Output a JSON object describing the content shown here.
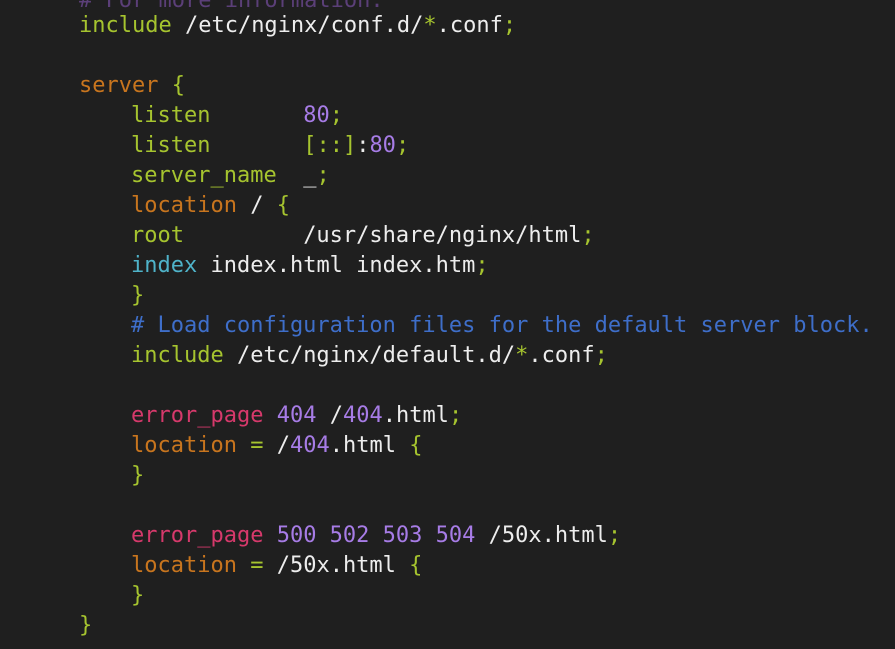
{
  "editor": {
    "colors": {
      "background": "#1f1f1f",
      "directive": "#a6c42f",
      "block_keyword": "#c8751e",
      "error_page": "#d6396b",
      "index": "#4fb3c9",
      "number": "#a77ce6",
      "comment": "#3e6ec9",
      "text": "#ededed"
    },
    "lines": [
      {
        "tokens": [
          {
            "t": "# For more information.",
            "c": "comment-faded"
          }
        ]
      },
      {
        "tokens": [
          {
            "t": "include",
            "c": "kw"
          },
          {
            "t": " /etc/nginx/conf.d/",
            "c": "text"
          },
          {
            "t": "*",
            "c": "kw"
          },
          {
            "t": ".conf",
            "c": "text"
          },
          {
            "t": ";",
            "c": "punct"
          }
        ]
      },
      {
        "tokens": []
      },
      {
        "tokens": [
          {
            "t": "server",
            "c": "orange"
          },
          {
            "t": " ",
            "c": "text"
          },
          {
            "t": "{",
            "c": "punct"
          }
        ]
      },
      {
        "tokens": [
          {
            "t": "listen",
            "c": "kw"
          },
          {
            "t": "       ",
            "c": "text"
          },
          {
            "t": "80",
            "c": "num"
          },
          {
            "t": ";",
            "c": "punct"
          }
        ]
      },
      {
        "tokens": [
          {
            "t": "listen",
            "c": "kw"
          },
          {
            "t": "       ",
            "c": "text"
          },
          {
            "t": "[::]",
            "c": "kw"
          },
          {
            "t": ":",
            "c": "text"
          },
          {
            "t": "80",
            "c": "num"
          },
          {
            "t": ";",
            "c": "punct"
          }
        ]
      },
      {
        "tokens": [
          {
            "t": "server_name",
            "c": "kw"
          },
          {
            "t": "  _",
            "c": "text"
          },
          {
            "t": ";",
            "c": "punct"
          }
        ]
      },
      {
        "tokens": [
          {
            "t": "location",
            "c": "orange"
          },
          {
            "t": " / ",
            "c": "text"
          },
          {
            "t": "{",
            "c": "punct"
          }
        ]
      },
      {
        "tokens": [
          {
            "t": "root",
            "c": "kw"
          },
          {
            "t": "         /usr/share/nginx/html",
            "c": "text"
          },
          {
            "t": ";",
            "c": "punct"
          }
        ]
      },
      {
        "tokens": [
          {
            "t": "index",
            "c": "cyan"
          },
          {
            "t": " index.html index.htm",
            "c": "text"
          },
          {
            "t": ";",
            "c": "punct"
          }
        ]
      },
      {
        "tokens": [
          {
            "t": "}",
            "c": "punct"
          }
        ]
      },
      {
        "tokens": [
          {
            "t": "# Load configuration files for the default server block.",
            "c": "comment"
          }
        ]
      },
      {
        "tokens": [
          {
            "t": "include",
            "c": "kw"
          },
          {
            "t": " /etc/nginx/default.d/",
            "c": "text"
          },
          {
            "t": "*",
            "c": "kw"
          },
          {
            "t": ".conf",
            "c": "text"
          },
          {
            "t": ";",
            "c": "punct"
          }
        ]
      },
      {
        "tokens": []
      },
      {
        "tokens": [
          {
            "t": "error_page",
            "c": "pink"
          },
          {
            "t": " ",
            "c": "text"
          },
          {
            "t": "404",
            "c": "num"
          },
          {
            "t": " /",
            "c": "text"
          },
          {
            "t": "404",
            "c": "num"
          },
          {
            "t": ".html",
            "c": "text"
          },
          {
            "t": ";",
            "c": "punct"
          }
        ]
      },
      {
        "tokens": [
          {
            "t": "location",
            "c": "orange"
          },
          {
            "t": " ",
            "c": "text"
          },
          {
            "t": "=",
            "c": "kw"
          },
          {
            "t": " /",
            "c": "text"
          },
          {
            "t": "404",
            "c": "num"
          },
          {
            "t": ".html ",
            "c": "text"
          },
          {
            "t": "{",
            "c": "punct"
          }
        ]
      },
      {
        "tokens": [
          {
            "t": "}",
            "c": "punct"
          }
        ]
      },
      {
        "tokens": []
      },
      {
        "tokens": [
          {
            "t": "error_page",
            "c": "pink"
          },
          {
            "t": " ",
            "c": "text"
          },
          {
            "t": "500 502 503 504",
            "c": "num"
          },
          {
            "t": " /50x.html",
            "c": "text"
          },
          {
            "t": ";",
            "c": "punct"
          }
        ]
      },
      {
        "tokens": [
          {
            "t": "location",
            "c": "orange"
          },
          {
            "t": " ",
            "c": "text"
          },
          {
            "t": "=",
            "c": "kw"
          },
          {
            "t": " /50x.html ",
            "c": "text"
          },
          {
            "t": "{",
            "c": "punct"
          }
        ]
      },
      {
        "tokens": [
          {
            "t": "}",
            "c": "punct"
          }
        ]
      },
      {
        "tokens": [
          {
            "t": "}",
            "c": "punct"
          }
        ]
      }
    ]
  }
}
